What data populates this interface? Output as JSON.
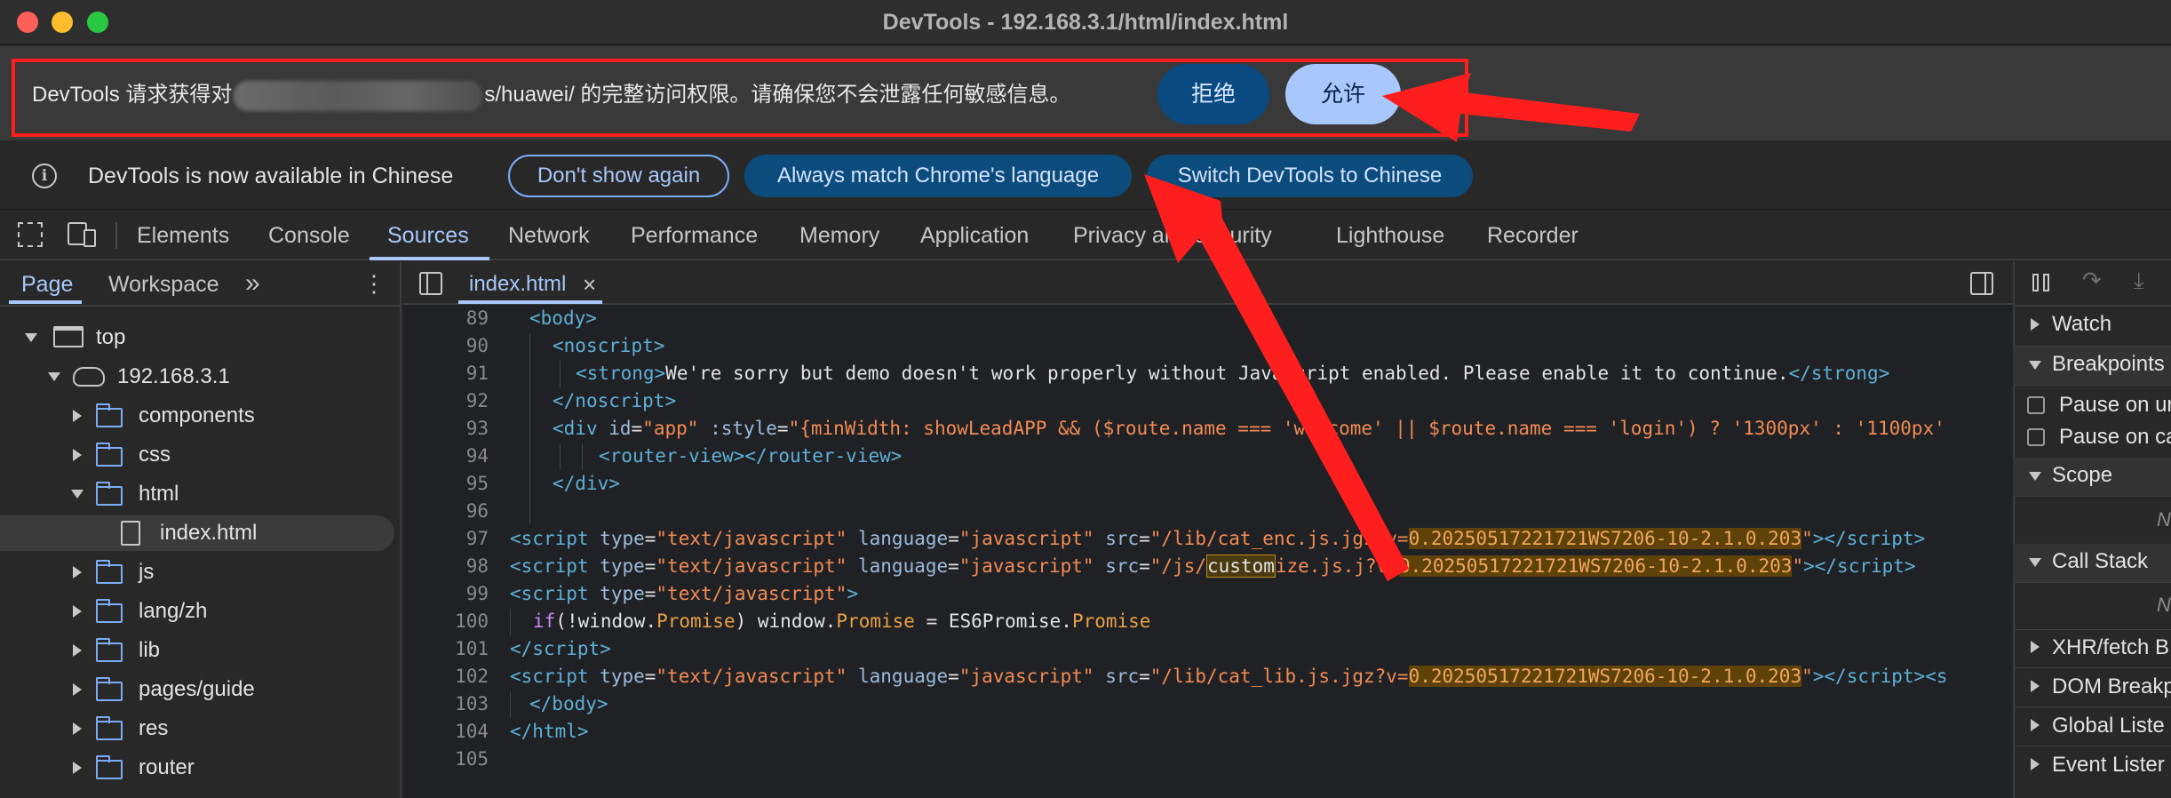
{
  "window": {
    "title": "DevTools - 192.168.3.1/html/index.html"
  },
  "permission_bar": {
    "text_prefix": "DevTools 请求获得对",
    "text_suffix": "s/huawei/ 的完整访问权限。请确保您不会泄露任何敏感信息。",
    "deny_label": "拒绝",
    "allow_label": "允许"
  },
  "language_bar": {
    "info_glyph": "i",
    "message": "DevTools is now available in Chinese",
    "dont_show_label": "Don't show again",
    "always_match_label": "Always match Chrome's language",
    "switch_label": "Switch DevTools to Chinese"
  },
  "main_tabs": [
    "Elements",
    "Console",
    "Sources",
    "Network",
    "Performance",
    "Memory",
    "Application",
    "Privacy and security",
    "Lighthouse",
    "Recorder"
  ],
  "active_main_tab": "Sources",
  "navigator": {
    "tabs": [
      "Page",
      "Workspace"
    ],
    "more_glyph": "»",
    "menu_glyph": "⋮",
    "tree": [
      {
        "label": "top"
      },
      {
        "label": "192.168.3.1"
      },
      {
        "label": "components"
      },
      {
        "label": "css"
      },
      {
        "label": "html"
      },
      {
        "label": "index.html"
      },
      {
        "label": "js"
      },
      {
        "label": "lang/zh"
      },
      {
        "label": "lib"
      },
      {
        "label": "pages/guide"
      },
      {
        "label": "res"
      },
      {
        "label": "router"
      }
    ]
  },
  "editor": {
    "file_tab": "index.html",
    "close_glyph": "×",
    "line_numbers": [
      "89",
      "90",
      "91",
      "92",
      "93",
      "94",
      "95",
      "96",
      "97",
      "98",
      "99",
      "100",
      "101",
      "102",
      "103",
      "104",
      "105"
    ]
  },
  "debugger_panel": {
    "watch": "Watch",
    "breakpoints": "Breakpoints",
    "pause_uncaught": "Pause on ur",
    "pause_caught": "Pause on ca",
    "scope": "Scope",
    "scope_empty": "N",
    "call_stack": "Call Stack",
    "call_stack_empty": "N",
    "xhr": "XHR/fetch B",
    "dom": "DOM Breakp",
    "global": "Global Liste",
    "event": "Event Lister"
  },
  "colors": {
    "highlight_red": "#ff1e1e",
    "accent_blue": "#a8c7fa",
    "tag_blue": "#5db0d7",
    "string_orange": "#f28b54"
  }
}
